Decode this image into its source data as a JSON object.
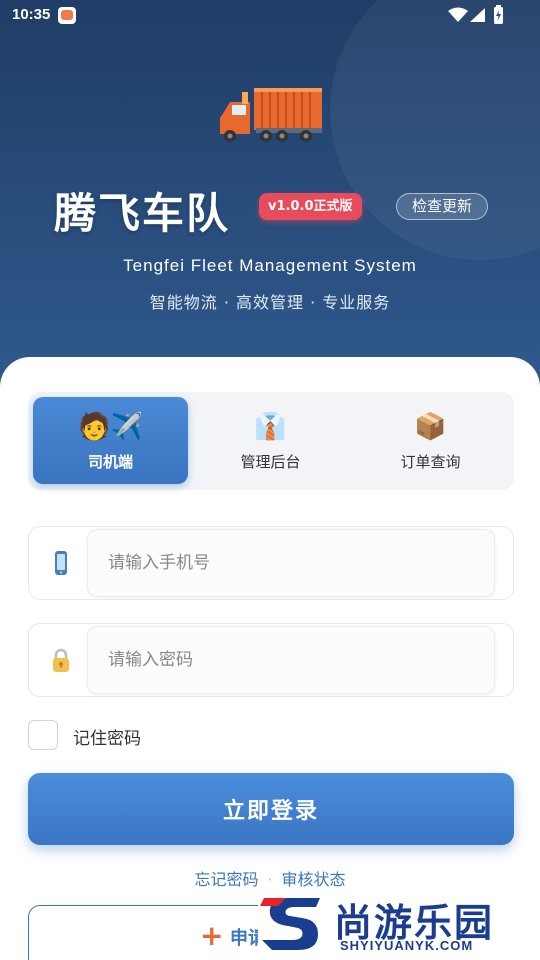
{
  "status_bar": {
    "time": "10:35"
  },
  "header": {
    "app_title": "腾飞车队",
    "version_badge": "v1.0.0正式版",
    "check_update_label": "检查更新",
    "subtitle_en": "Tengfei Fleet Management System",
    "subtitle_cn": "智能物流 · 高效管理 · 专业服务"
  },
  "role_tabs": [
    {
      "label": "司机端",
      "icon": "driver-plane-emoji",
      "active": true
    },
    {
      "label": "管理后台",
      "icon": "necktie-emoji",
      "active": false
    },
    {
      "label": "订单查询",
      "icon": "package-emoji",
      "active": false
    }
  ],
  "form": {
    "phone_placeholder": "请输入手机号",
    "password_placeholder": "请输入密码",
    "remember_label": "记住密码",
    "remember_checked": false
  },
  "login_label": "立即登录",
  "links": {
    "forgot": "忘记密码",
    "separator": "·",
    "review": "审核状态"
  },
  "apply": {
    "label": "申请"
  },
  "watermark": {
    "brand_cn": "尚游乐园",
    "brand_url": "SHYIYUANYK.COM"
  },
  "colors": {
    "primary": "#3a76c4",
    "header_bg": "#1f3d66",
    "badge": "#e84c5c",
    "accent": "#e8682e"
  }
}
